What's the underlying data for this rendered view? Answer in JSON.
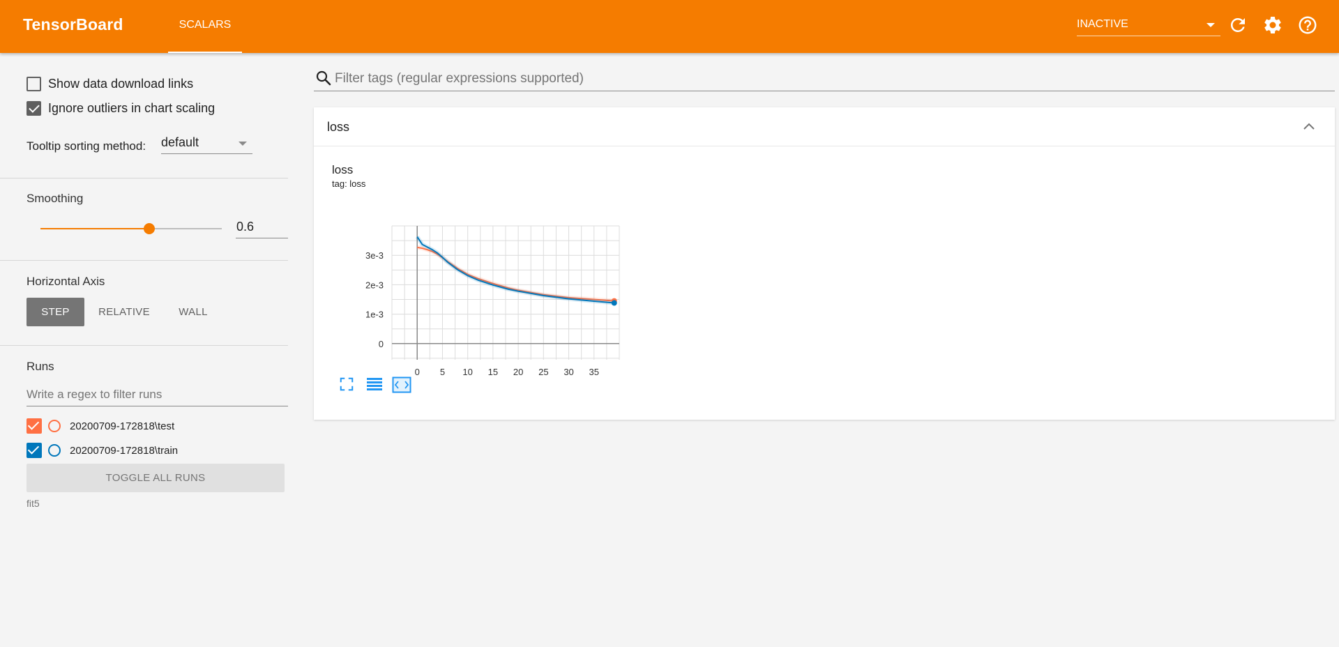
{
  "topbar": {
    "brand": "TensorBoard",
    "tab_label": "SCALARS",
    "status_value": "INACTIVE",
    "icons": [
      "refresh-icon",
      "settings-gear-icon",
      "help-icon"
    ],
    "accent_color": "#f57c00"
  },
  "sidebar": {
    "show_download_links": {
      "label": "Show data download links",
      "checked": false
    },
    "ignore_outliers": {
      "label": "Ignore outliers in chart scaling",
      "checked": true
    },
    "tooltip_sorting": {
      "label": "Tooltip sorting method:",
      "value": "default"
    },
    "smoothing": {
      "label": "Smoothing",
      "value": "0.6",
      "level": 0.6
    },
    "horizontal_axis": {
      "label": "Horizontal Axis",
      "options": [
        "STEP",
        "RELATIVE",
        "WALL"
      ],
      "selected": "STEP"
    },
    "runs": {
      "label": "Runs",
      "filter_placeholder": "Write a regex to filter runs",
      "items": [
        {
          "name": "20200709-172818\\test",
          "color": "#ff7043",
          "checked": true
        },
        {
          "name": "20200709-172818\\train",
          "color": "#0077bb",
          "checked": true
        }
      ],
      "toggle_label": "TOGGLE ALL RUNS",
      "footer": "fit5"
    }
  },
  "main": {
    "filter_placeholder": "Filter tags (regular expressions supported)",
    "card": {
      "title": "loss",
      "chart_title": "loss",
      "chart_tag": "tag: loss"
    }
  },
  "chart_data": {
    "type": "line",
    "title": "loss",
    "subtitle": "tag: loss",
    "xlabel": "",
    "ylabel": "",
    "x_ticks": [
      0,
      5,
      10,
      15,
      20,
      25,
      30,
      35
    ],
    "y_ticks": [
      "0",
      "1e-3",
      "2e-3",
      "3e-3"
    ],
    "y_tick_values": [
      0,
      0.001,
      0.002,
      0.003
    ],
    "xlim": [
      -5,
      40
    ],
    "ylim": [
      -0.00055,
      0.004
    ],
    "grid": true,
    "series": [
      {
        "name": "20200709-172818\\test",
        "color": "#ff7043",
        "x": [
          0,
          1,
          2,
          3,
          4,
          5,
          6,
          8,
          10,
          12,
          15,
          18,
          20,
          25,
          30,
          35,
          39
        ],
        "y": [
          0.00327,
          0.00324,
          0.00319,
          0.00313,
          0.00304,
          0.00292,
          0.00279,
          0.00255,
          0.00235,
          0.00221,
          0.00204,
          0.00189,
          0.00181,
          0.00166,
          0.00156,
          0.0015,
          0.00145
        ]
      },
      {
        "name": "20200709-172818\\train",
        "color": "#0077bb",
        "x": [
          0,
          1,
          2,
          3,
          4,
          5,
          6,
          8,
          10,
          12,
          15,
          18,
          20,
          25,
          30,
          35,
          39
        ],
        "y": [
          0.00363,
          0.00337,
          0.00328,
          0.00319,
          0.00308,
          0.00293,
          0.00277,
          0.00251,
          0.00231,
          0.00216,
          0.00199,
          0.00185,
          0.00178,
          0.00163,
          0.00152,
          0.00144,
          0.00138
        ]
      }
    ]
  }
}
